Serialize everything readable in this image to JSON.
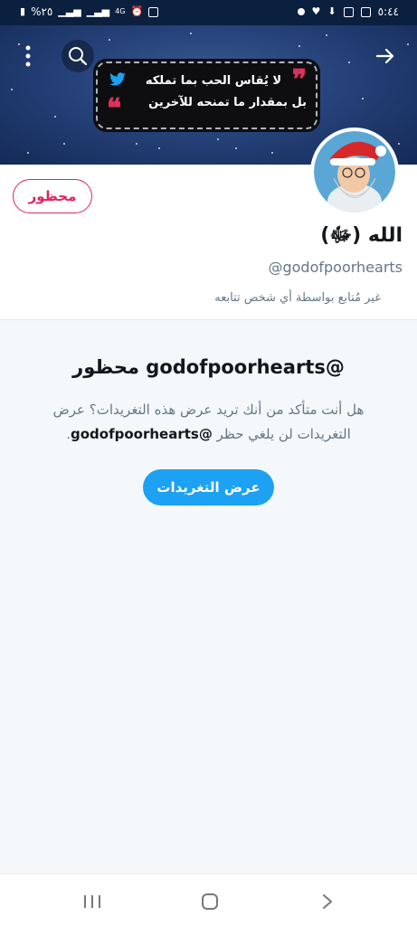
{
  "status_bar": {
    "time": "٥:٤٤",
    "battery": "%٢٥",
    "network": "4G"
  },
  "banner": {
    "quote_line1": "لا يُقاس الحب بما تملكه",
    "quote_line2": "بل بمقدار ما تمنحه للآخرين",
    "quote_open": "❞",
    "quote_close": "❝",
    "twitter_color": "#1da1f2",
    "quote_accent": "#e0315a"
  },
  "profile": {
    "blocked_label": "محظور",
    "display_name": "الله (ﷻ)",
    "handle": "@godofpoorhearts",
    "not_followed": "غير مُتابع بواسطة أي شخص تتابعه"
  },
  "blocked": {
    "title": "@godofpoorhearts محظور",
    "text_part1": "هل أنت متأكد من أنك تريد عرض هذه التغريدات؟ عرض التغريدات لن يلغي حظر ",
    "text_handle": "@godofpoorhearts",
    "text_part2": ".",
    "view_button": "عرض التغريدات"
  },
  "colors": {
    "accent_blue": "#1da1f2",
    "blocked_red": "#e0245e",
    "muted_text": "#657786"
  }
}
